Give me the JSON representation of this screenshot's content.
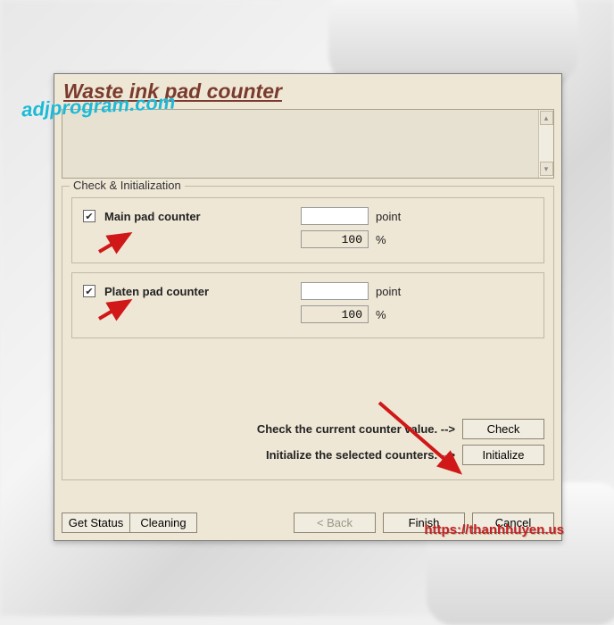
{
  "title": "Waste ink pad counter",
  "fieldset_legend": "Check & Initialization",
  "main": {
    "label": "Main pad counter",
    "checked": true,
    "point_value": "",
    "pct_value": "100",
    "unit_point": "point",
    "unit_pct": "%"
  },
  "platen": {
    "label": "Platen pad counter",
    "checked": true,
    "point_value": "",
    "pct_value": "100",
    "unit_point": "point",
    "unit_pct": "%"
  },
  "actions": {
    "check_text": "Check the current counter value. -->",
    "check_btn": "Check",
    "init_text": "Initialize the selected counters. -->",
    "init_btn": "Initialize"
  },
  "bottom": {
    "get_status": "Get Status",
    "cleaning": "Cleaning",
    "back": "< Back",
    "finish": "Finish",
    "cancel": "Cancel"
  },
  "watermarks": {
    "w1": "adjprogram.com",
    "w2": "https://thanhhuyen.us"
  }
}
